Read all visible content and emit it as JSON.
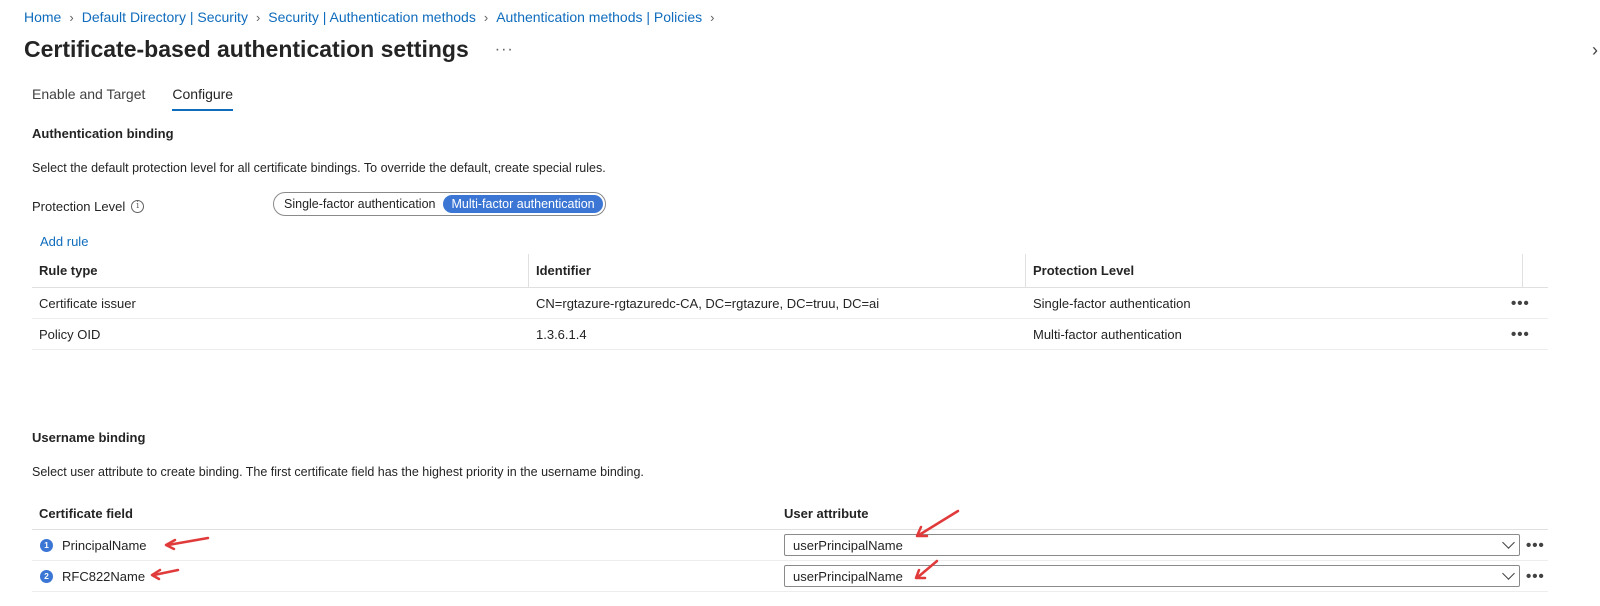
{
  "breadcrumb": [
    "Home",
    "Default Directory | Security",
    "Security | Authentication methods",
    "Authentication methods | Policies"
  ],
  "title": "Certificate-based authentication settings",
  "title_more": "···",
  "tabs": [
    {
      "label": "Enable and Target",
      "active": false
    },
    {
      "label": "Configure",
      "active": true
    }
  ],
  "auth_binding": {
    "heading": "Authentication binding",
    "description": "Select the default protection level for all certificate bindings. To override the default, create special rules.",
    "protection_label": "Protection Level",
    "options": [
      "Single-factor authentication",
      "Multi-factor authentication"
    ],
    "selected": "Multi-factor authentication",
    "add_rule": "Add rule",
    "columns": [
      "Rule type",
      "Identifier",
      "Protection Level"
    ],
    "rows": [
      {
        "rule_type": "Certificate issuer",
        "identifier": "CN=rgtazure-rgtazuredc-CA, DC=rgtazure, DC=truu, DC=ai",
        "level": "Single-factor authentication"
      },
      {
        "rule_type": "Policy OID",
        "identifier": "1.3.6.1.4",
        "level": "Multi-factor authentication"
      }
    ]
  },
  "username_binding": {
    "heading": "Username binding",
    "description": "Select user attribute to create binding. The first certificate field has the highest priority in the username binding.",
    "columns": [
      "Certificate field",
      "User attribute"
    ],
    "rows": [
      {
        "num": "1",
        "field": "PrincipalName",
        "attribute": "userPrincipalName"
      },
      {
        "num": "2",
        "field": "RFC822Name",
        "attribute": "userPrincipalName"
      }
    ]
  },
  "colors": {
    "accent": "#0f6cbd",
    "toggle_selected": "#3b76d4",
    "annotation_arrow": "#e03a3a"
  },
  "icons": [
    "info-icon",
    "chevron-right-icon",
    "chevron-down-icon",
    "more-icon",
    "collapse-icon"
  ]
}
